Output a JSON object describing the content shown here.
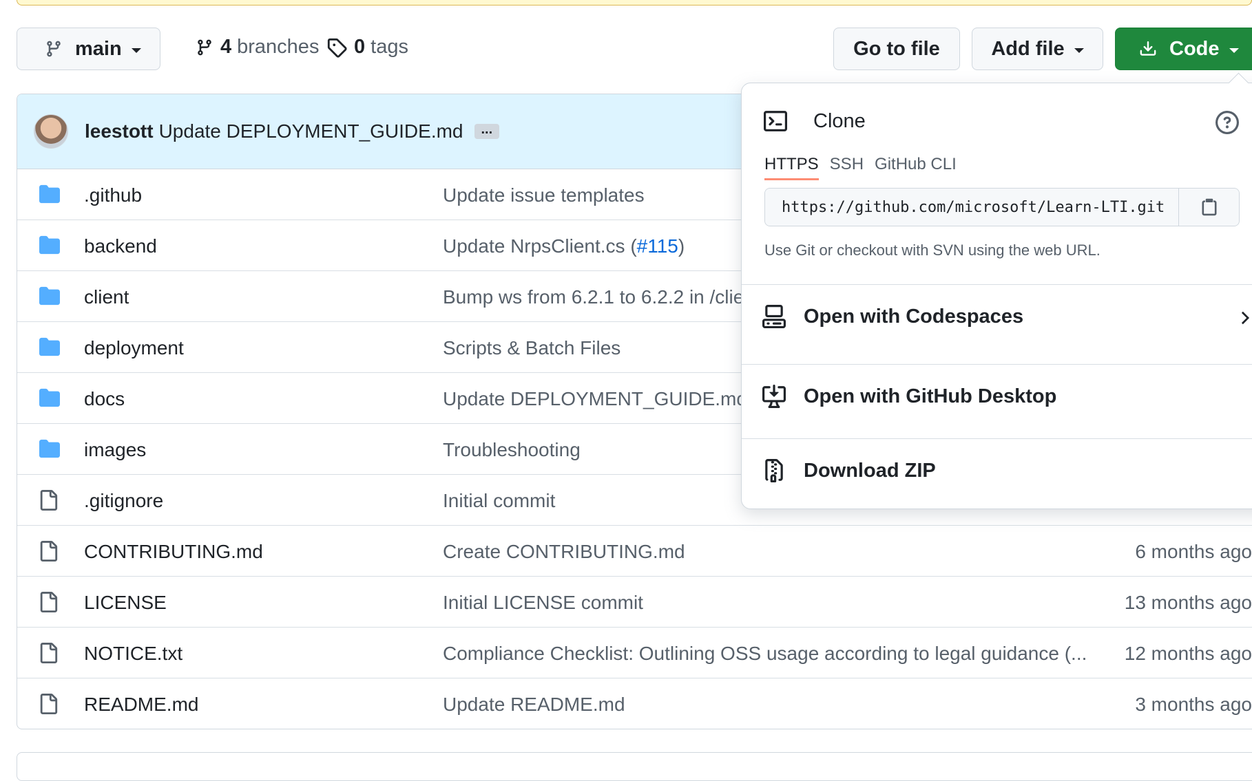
{
  "toolbar": {
    "branch_label": "main",
    "branches_count": "4",
    "branches_label": "branches",
    "tags_count": "0",
    "tags_label": "tags",
    "go_to_file_label": "Go to file",
    "add_file_label": "Add file",
    "code_label": "Code"
  },
  "latest_commit": {
    "author": "leestott",
    "message": "Update DEPLOYMENT_GUIDE.md",
    "ellipsis": "..."
  },
  "files": [
    {
      "type": "folder",
      "name": ".github",
      "message": "Update issue templates",
      "age": ""
    },
    {
      "type": "folder",
      "name": "backend",
      "message": "Update NrpsClient.cs (",
      "link": "#115",
      "message_suffix": ")",
      "age": ""
    },
    {
      "type": "folder",
      "name": "client",
      "message": "Bump ws from 6.2.1 to 6.2.2 in /clie",
      "age": ""
    },
    {
      "type": "folder",
      "name": "deployment",
      "message": "Scripts & Batch Files",
      "age": ""
    },
    {
      "type": "folder",
      "name": "docs",
      "message": "Update DEPLOYMENT_GUIDE.md",
      "age": ""
    },
    {
      "type": "folder",
      "name": "images",
      "message": "Troubleshooting",
      "age": ""
    },
    {
      "type": "file",
      "name": ".gitignore",
      "message": "Initial commit",
      "age": ""
    },
    {
      "type": "file",
      "name": "CONTRIBUTING.md",
      "message": "Create CONTRIBUTING.md",
      "age": "6 months ago"
    },
    {
      "type": "file",
      "name": "LICENSE",
      "message": "Initial LICENSE commit",
      "age": "13 months ago"
    },
    {
      "type": "file",
      "name": "NOTICE.txt",
      "message": "Compliance Checklist: Outlining OSS usage according to legal guidance (...",
      "age": "12 months ago"
    },
    {
      "type": "file",
      "name": "README.md",
      "message": "Update README.md",
      "age": "3 months ago"
    }
  ],
  "clone_panel": {
    "title": "Clone",
    "tabs": [
      "HTTPS",
      "SSH",
      "GitHub CLI"
    ],
    "active_tab": "HTTPS",
    "url": "https://github.com/microsoft/Learn-LTI.git",
    "hint": "Use Git or checkout with SVN using the web URL.",
    "codespaces_label": "Open with Codespaces",
    "desktop_label": "Open with GitHub Desktop",
    "zip_label": "Download ZIP"
  },
  "colors": {
    "code_button": "#1f883d",
    "commit_header_bg": "#ddf4ff",
    "folder_icon": "#54aeff",
    "link": "#0969da",
    "active_tab_underline": "#fd8c73"
  }
}
